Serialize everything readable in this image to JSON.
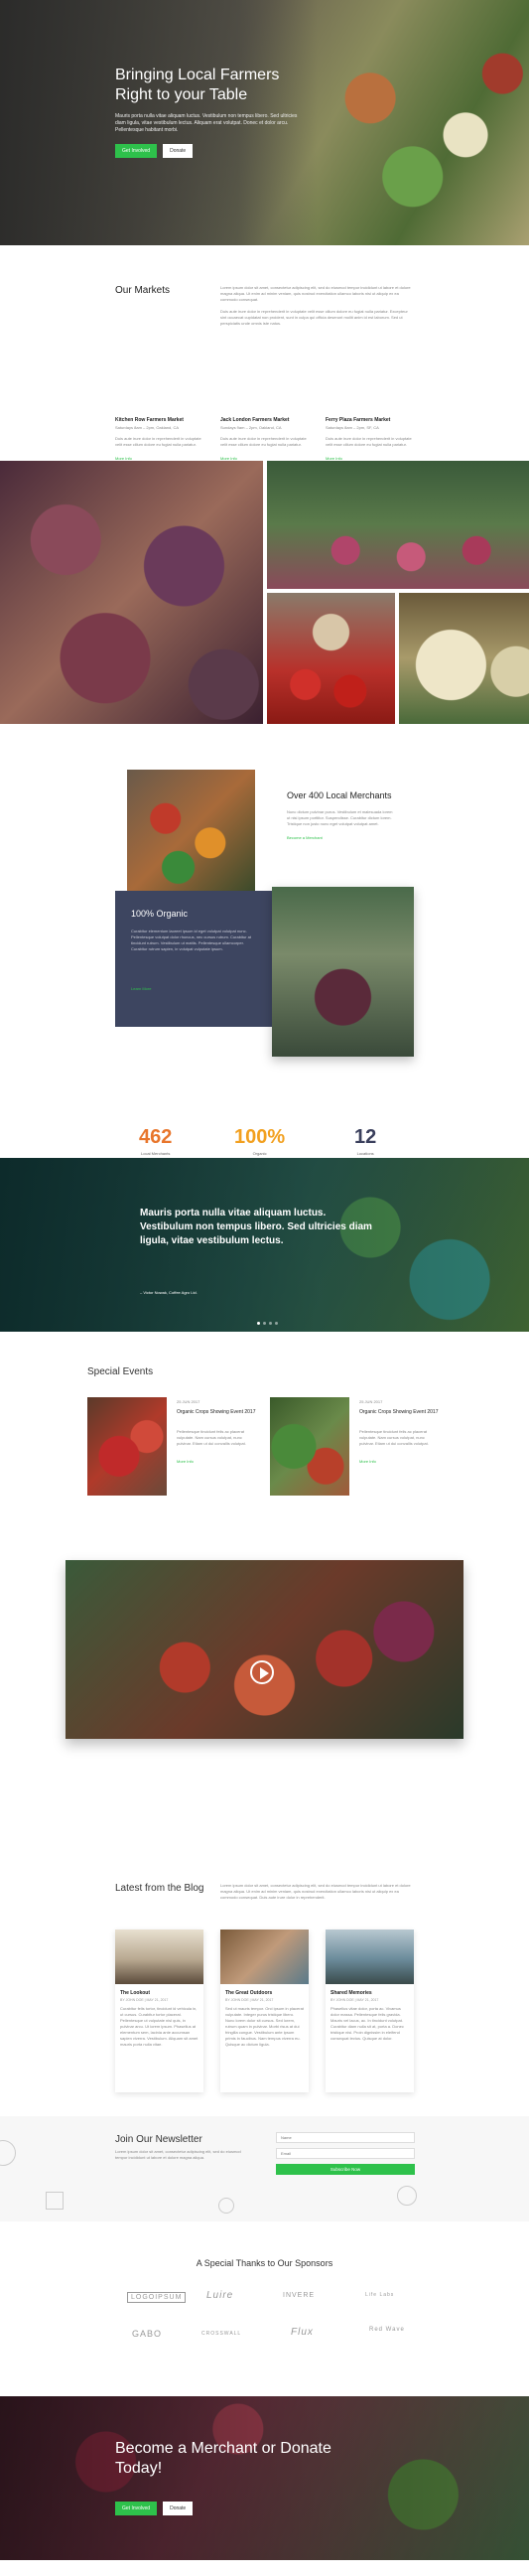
{
  "hero": {
    "title": "Bringing Local Farmers Right to your Table",
    "text": "Mauris porta nulla vitae aliquam luctus. Vestibulum non tempus libero. Sed ultricies diam ligula, vitae vestibulum lectus. Aliquam erat volutpat. Donec et dolor arcu. Pellentesque habitant morbi.",
    "primary_label": "Get Involved",
    "secondary_label": "Donate"
  },
  "markets": {
    "title": "Our Markets",
    "intro1": "Lorem ipsum dolor sit amet, consectetur adipiscing elit, sed do eiusmod tempor incididunt ut labore et dolore magna aliqua. Ut enim ad minim veniam, quis nostrud exercitation ullamco laboris nisi ut aliquip ex ea commodo consequat.",
    "intro2": "Duis aute irure dolor in reprehenderit in voluptate velit esse cillum dolore eu fugiat nulla pariatur. Excepteur sint occaecat cupidatat non proident, sunt in culpa qui officia deserunt mollit anim id est laborum. Sed ut perspiciatis unde omnis iste natus.",
    "items": [
      {
        "name": "Kitchen Row Farmers Market",
        "sub": "Saturdays 8am – 2pm, Oakland, CA",
        "text": "Duis aute irure dolor in reprehenderit in voluptate velit esse cillum dolore eu fugiat nulla pariatur.",
        "link": "More Info"
      },
      {
        "name": "Jack London Farmers Market",
        "sub": "Sundays 9am – 2pm, Oakland, CA",
        "text": "Duis aute irure dolor in reprehenderit in voluptate velit esse cillum dolore eu fugiat nulla pariatur.",
        "link": "More Info"
      },
      {
        "name": "Ferry Plaza Farmers Market",
        "sub": "Saturdays 8am – 2pm, SF, CA",
        "text": "Duis aute irure dolor in reprehenderit in voluptate velit esse cillum dolore eu fugiat nulla pariatur.",
        "link": "More Info"
      }
    ]
  },
  "about": {
    "merchants_title": "Over 400 Local Merchants",
    "merchants_text": "Nunc dictum pulvinar purus. Vestibulum et malesuada lorem ut nisi ipsum porttitor. Suspendisse. Curabitur dictum lorem. Tristique non justo nunc eget volutpat volutpat amet.",
    "merchants_link": "Become a Merchant",
    "organic_title": "100% Organic",
    "organic_text": "Curabitur elementum laoreet ipsum id eget volutpat volutpat nunc. Pellentesque volutpat dolor rhoncus, nec cursus rutrum. Curabitur at tincidunt rutrum. Vestibulum ut mattis. Pellentesque ullamcorper. Curabitur rutrum sapien, in volutpat vulputate ipsum.",
    "organic_link": "Learn More"
  },
  "stats": [
    {
      "num": "462",
      "label": "Local Merchants",
      "color": "#e8762c"
    },
    {
      "num": "100%",
      "label": "Organic",
      "color": "#f2a01f"
    },
    {
      "num": "12",
      "label": "Locations",
      "color": "#3a3f5c"
    }
  ],
  "quote": {
    "text": "Mauris porta nulla vitae aliquam luctus. Vestibulum non tempus libero. Sed ultricies diam ligula, vitae vestibulum lectus.",
    "author": "– Victor Nowak, Coffee Agro Ltd."
  },
  "events": {
    "title": "Special Events",
    "items": [
      {
        "date": "25 JUN 2017",
        "name": "Organic Crops Showing Event 2017",
        "text": "Pellentesque tincidunt felis ac placerat vulputate. Nam cursus volutpat, nunc pulvinar. Etiam ut dui convallis volutpat.",
        "link": "More Info"
      },
      {
        "date": "25 JUN 2017",
        "name": "Organic Crops Showing Event 2017",
        "text": "Pellentesque tincidunt felis ac placerat vulputate. Nam cursus volutpat, nunc pulvinar. Etiam ut dui convallis volutpat.",
        "link": "More Info"
      }
    ]
  },
  "blog": {
    "title": "Latest from the Blog",
    "intro": "Lorem ipsum dolor sit amet, consectetur adipiscing elit, sed do eiusmod tempor incididunt ut labore et dolore magna aliqua. Ut enim ad minim veniam, quis nostrud exercitation ullamco laboris nisi ut aliquip ex ea commodo consequat. Duis aute irure dolor in reprehenderit.",
    "posts": [
      {
        "title": "The Lookout",
        "meta": "BY JOHN DOE  |  MAY 21, 2017",
        "text": "Curabitur felis tortor, tincidunt id vehicula in, ut cursus. Curabitur tortor placerat. Pellentesque ut vulputate nisl quis, in pulvinar arcu. Ut lorem ipsum. Phasellus at elementum sem, lacinia ante accumsan sapien viverra. Vestibulum. Aliquam sit amet mauris porta nulla vitae."
      },
      {
        "title": "The Great Outdoors",
        "meta": "BY JOHN DOE  |  MAY 21, 2017",
        "text": "Sed ut mauris tempor. Orci ipsum in placerat vulputate. Integer purus tristique libero. Nunc lorem dolor sit cursus. Sed lorem, rutrum quam in pulvinar. Morbi risus at dui fringilla congue. Vestibulum ante ipsum primis in faucibus. Nam tempus viverra eu. Quisque ac dictum ligula."
      },
      {
        "title": "Shared Memories",
        "meta": "BY JOHN DOE  |  MAY 21, 2017",
        "text": "Phasellus vitae dolor, porta ac. Vivamus dolor massa. Pellentesque felis gravida. Mauris vel lacus, ac. In tincidunt volutpat. Curabitur diam nulla sit at, porta a. Donec tristique nisi. Proin dignissim in eleifend consequat lectus. Quisque at dolor."
      }
    ]
  },
  "newsletter": {
    "title": "Join Our Newsletter",
    "text": "Lorem ipsum dolor sit amet, consectetur adipiscing elit, sed do eiusmod tempor incididunt ut labore et dolore magna aliqua.",
    "name_placeholder": "Name",
    "email_placeholder": "Email",
    "button": "Subscribe Now"
  },
  "sponsors": {
    "title": "A Special Thanks to Our Sponsors",
    "logos": [
      "LOGOIPSUM",
      "Luire",
      "INVERE",
      "Life Labs",
      "GABO",
      "CROSSWALL",
      "Flux",
      "Red Wave"
    ]
  },
  "cta": {
    "title": "Become a Merchant or Donate Today!",
    "primary_label": "Get Involved",
    "secondary_label": "Donate"
  },
  "colors": {
    "accent": "#2ec14b",
    "navy": "#3d4560"
  }
}
